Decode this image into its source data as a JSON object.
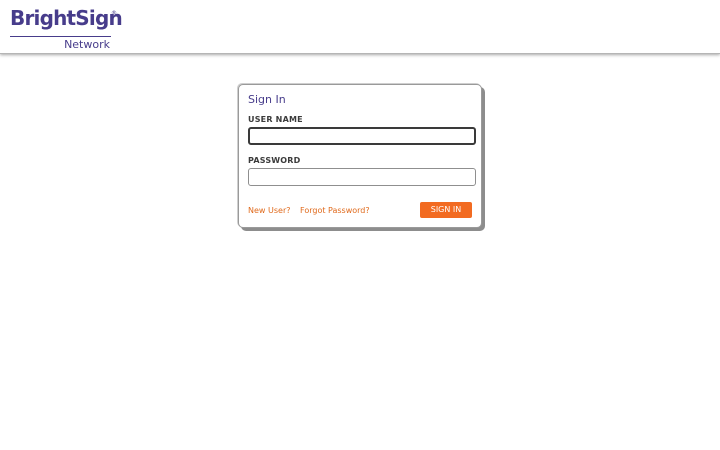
{
  "header": {
    "logo": {
      "brand": "BrightSign",
      "registered": "®",
      "sub": "Network"
    }
  },
  "signin": {
    "title": "Sign In",
    "username_label": "USER NAME",
    "username_value": "",
    "password_label": "PASSWORD",
    "password_value": "",
    "new_user_link": "New User?",
    "forgot_password_link": "Forgot Password?",
    "submit_label": "SIGN IN"
  },
  "colors": {
    "brand_purple": "#473c8b",
    "accent_orange": "#f26b21",
    "link_orange": "#e06a1c"
  }
}
